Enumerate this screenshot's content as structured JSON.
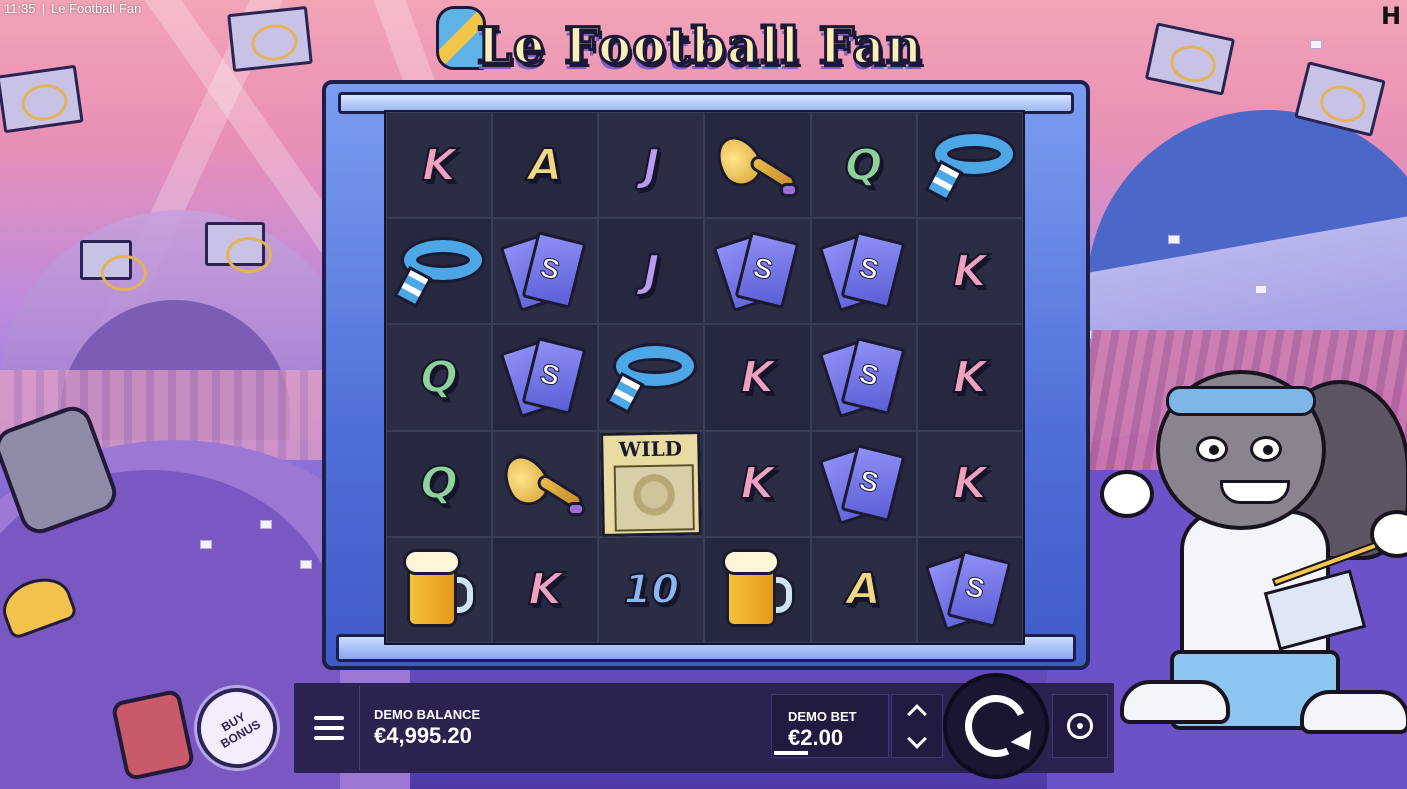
{
  "status_bar": {
    "time": "11:35",
    "separator": "|",
    "game_name": "Le Football Fan"
  },
  "provider_logo": "H",
  "title": "Le Football Fan",
  "reels": {
    "rows": [
      [
        "K",
        "A",
        "J",
        "horn",
        "Q",
        "scarf"
      ],
      [
        "scarf",
        "ticket",
        "J",
        "ticket",
        "ticket",
        "K"
      ],
      [
        "Q",
        "ticket",
        "scarf",
        "K",
        "ticket",
        "K"
      ],
      [
        "Q",
        "horn",
        "wild",
        "K",
        "ticket",
        "K"
      ],
      [
        "beer",
        "K",
        "10",
        "beer",
        "A",
        "ticket"
      ]
    ],
    "wild_label": "WILD",
    "ticket_letter": "S",
    "symbol_colors": {
      "K": "#f0a0c0",
      "A": "#f2d783",
      "J": "#b79cf2",
      "Q": "#8fd19a",
      "10": "#8cb6f2"
    }
  },
  "controls": {
    "buy_bonus_line1": "BUY",
    "buy_bonus_line2": "BONUS",
    "menu_icon": "hamburger-icon",
    "balance_label": "DEMO BALANCE",
    "balance_value": "€4,995.20",
    "bet_label": "DEMO BET",
    "bet_value": "€2.00",
    "bet_up_icon": "chevron-up-icon",
    "bet_down_icon": "chevron-down-icon",
    "spin_icon": "spin-arrow-icon",
    "autoplay_icon": "autoplay-icon"
  },
  "theme": {
    "bar_background": "#2c2250",
    "frame_blue": "#4f6fd8",
    "grid_background": "#2b2d44"
  }
}
